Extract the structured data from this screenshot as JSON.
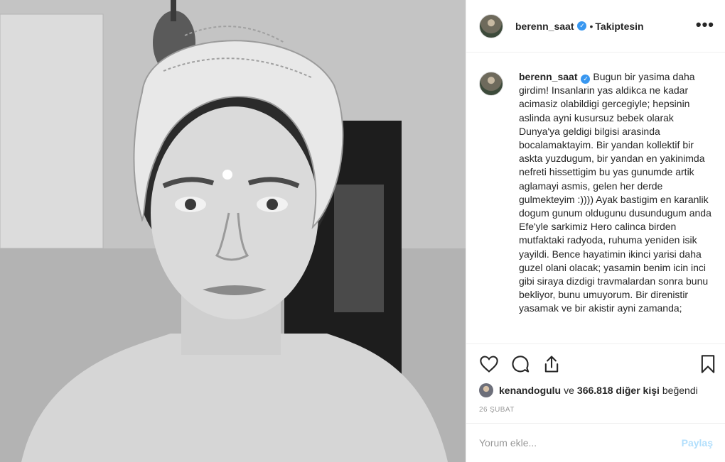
{
  "post": {
    "username": "berenn_saat",
    "verified": true,
    "follow_status": "Takiptesin",
    "separator": "•",
    "more_label": "•••",
    "photo_alt": "Black and white selfie of a woman wearing a knit head wrap"
  },
  "caption": {
    "username": "berenn_saat",
    "text": "Bugun bir yasima daha girdim! Insanlarin yas aldikca ne kadar acimasiz olabildigi gercegiyle; hepsinin aslinda ayni kusursuz bebek olarak Dunya'ya geldigi bilgisi arasinda bocalamaktayim. Bir yandan kollektif bir askta yuzdugum, bir yandan en yakinimda nefreti hissettigim bu yas gunumde artik aglamayi asmis, gelen her derde gulmekteyim :)))) Ayak bastigim en karanlik dogum gunum oldugunu dusundugum anda Efe'yle sarkimiz Hero calinca birden mutfaktaki radyoda, ruhuma yeniden isik yayildi. Bence hayatimin ikinci yarisi daha guzel olani olacak; yasamin benim icin inci gibi siraya dizdigi travmalardan sonra bunu bekliyor, bunu umuyorum. Bir direnistir yasamak ve bir akistir ayni zamanda;"
  },
  "actions": {
    "like_icon": "heart-icon",
    "comment_icon": "comment-icon",
    "share_icon": "share-icon",
    "save_icon": "bookmark-icon"
  },
  "likes": {
    "liker": "kenandogulu",
    "connector": "ve",
    "others": "366.818 diğer kişi",
    "suffix": "beğendi"
  },
  "date": "26 ŞUBAT",
  "comment_box": {
    "placeholder": "Yorum ekle...",
    "post_label": "Paylaş"
  },
  "colors": {
    "verified_blue": "#3897f0",
    "post_disabled": "#b2dffc",
    "muted_text": "#999999",
    "border": "#efefef"
  }
}
